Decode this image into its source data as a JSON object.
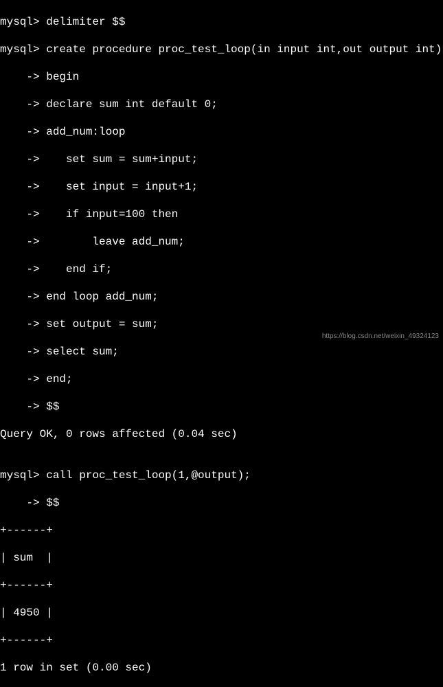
{
  "lines": [
    "mysql> delimiter $$",
    "mysql> create procedure proc_test_loop(in input int,out output int)",
    "    -> begin",
    "    -> declare sum int default 0;",
    "    -> add_num:loop",
    "    ->    set sum = sum+input;",
    "    ->    set input = input+1;",
    "    ->    if input=100 then",
    "    ->        leave add_num;",
    "    ->    end if;",
    "    -> end loop add_num;",
    "    -> set output = sum;",
    "    -> select sum;",
    "    -> end;",
    "    -> $$",
    "Query OK, 0 rows affected (0.04 sec)",
    "",
    "mysql> call proc_test_loop(1,@output);",
    "    -> $$",
    "+------+",
    "| sum  |",
    "+------+",
    "| 4950 |",
    "+------+",
    "1 row in set (0.00 sec)"
  ],
  "watermark": "https://blog.csdn.net/weixin_49324123"
}
